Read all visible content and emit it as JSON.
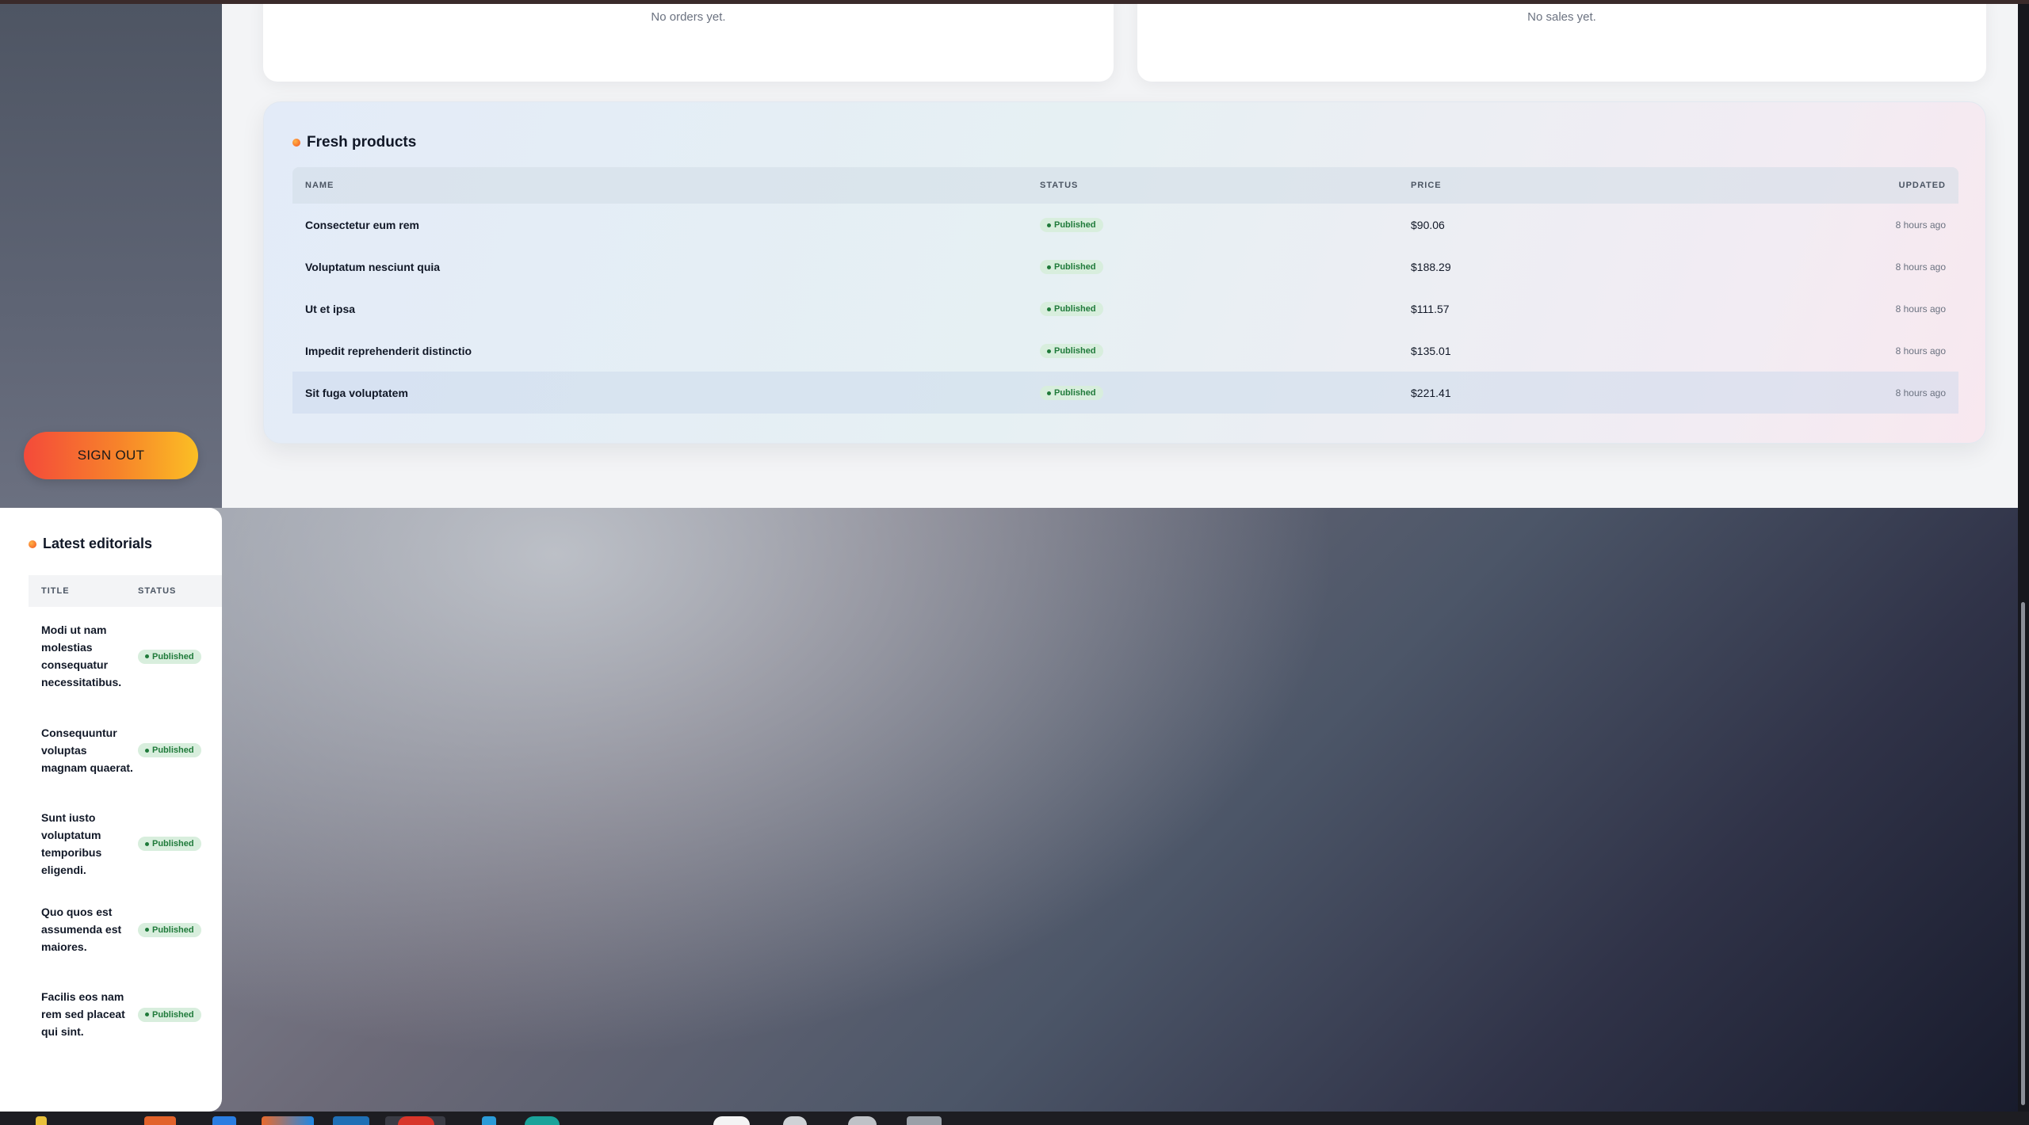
{
  "top_cards": [
    {
      "empty_text": "No orders yet."
    },
    {
      "empty_text": "No sales yet."
    }
  ],
  "sidebar": {
    "sign_out_label": "SIGN OUT"
  },
  "fresh_products": {
    "title": "Fresh products",
    "columns": {
      "name": "NAME",
      "status": "STATUS",
      "price": "PRICE",
      "updated": "UPDATED"
    },
    "rows": [
      {
        "name": "Consectetur eum rem",
        "status": "Published",
        "price": "$90.06",
        "updated": "8 hours ago"
      },
      {
        "name": "Voluptatum nesciunt quia",
        "status": "Published",
        "price": "$188.29",
        "updated": "8 hours ago"
      },
      {
        "name": "Ut et ipsa",
        "status": "Published",
        "price": "$111.57",
        "updated": "8 hours ago"
      },
      {
        "name": "Impedit reprehenderit distinctio",
        "status": "Published",
        "price": "$135.01",
        "updated": "8 hours ago"
      },
      {
        "name": "Sit fuga voluptatem",
        "status": "Published",
        "price": "$221.41",
        "updated": "8 hours ago"
      }
    ]
  },
  "latest_editorials": {
    "title": "Latest editorials",
    "columns": {
      "title": "TITLE",
      "status": "STATUS"
    },
    "rows": [
      {
        "title": "Modi ut nam molestias consequatur necessitatibus.",
        "status": "Published"
      },
      {
        "title": "Consequuntur voluptas magnam quaerat.",
        "status": "Published"
      },
      {
        "title": "Sunt iusto voluptatum temporibus eligendi.",
        "status": "Published"
      },
      {
        "title": "Quo quos est assumenda est maiores.",
        "status": "Published"
      },
      {
        "title": "Facilis eos nam rem sed placeat qui sint.",
        "status": "Published"
      }
    ]
  },
  "colors": {
    "accent_gradient_start": "#f44a3a",
    "accent_gradient_end": "#fbbf24",
    "published_badge_bg": "#d8eedd",
    "published_badge_text": "#1f7a3a"
  }
}
